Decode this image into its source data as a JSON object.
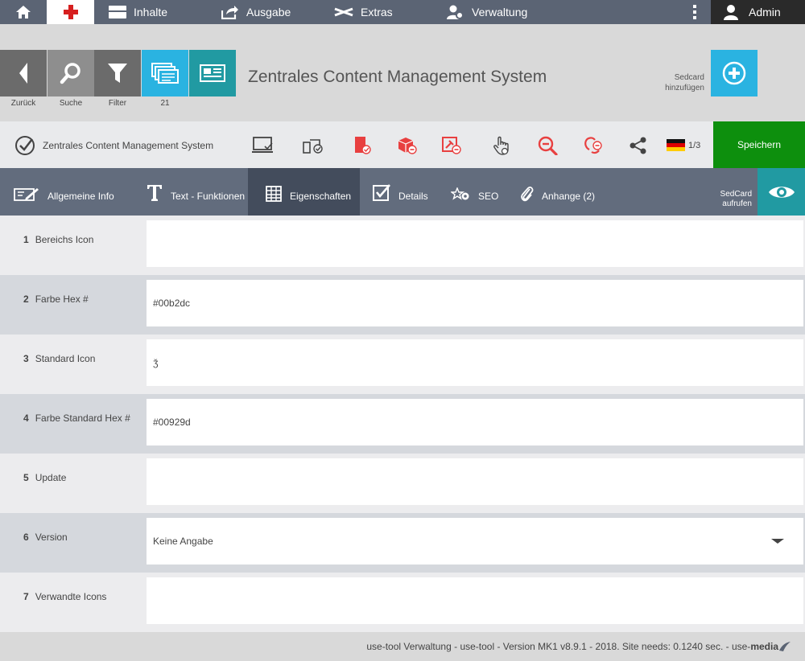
{
  "topnav": {
    "items": [
      {
        "label": "Inhalte",
        "icon": "card-icon"
      },
      {
        "label": "Ausgabe",
        "icon": "share-icon"
      },
      {
        "label": "Extras",
        "icon": "tools-icon"
      },
      {
        "label": "Verwaltung",
        "icon": "user-gear-icon"
      }
    ],
    "admin_label": "Admin",
    "accent_red": "#d61f1f"
  },
  "toolbar": {
    "back_label": "Zurück",
    "search_label": "Suche",
    "filter_label": "Filter",
    "cards_count": "21",
    "title": "Zentrales Content Management System",
    "add_label_line1": "Sedcard",
    "add_label_line2": "hinzufügen"
  },
  "actionbar": {
    "document_label": "Zentrales Content Management System",
    "lang_label": "1/3",
    "save_label": "Speichern",
    "icons": [
      "monitor-check-icon",
      "devices-check-icon",
      "tablet-check-icon",
      "box-remove-icon",
      "pin-remove-icon",
      "hand-pointer-icon",
      "zoom-out-icon",
      "unlink-icon",
      "share-icon"
    ]
  },
  "tabs": [
    {
      "label": "Allgemeine Info",
      "icon": "edit-card-icon"
    },
    {
      "label": "Text - Funktionen",
      "icon": "text-icon"
    },
    {
      "label": "Eigenschaften",
      "icon": "table-icon",
      "active": true
    },
    {
      "label": "Details",
      "icon": "checkbox-icon"
    },
    {
      "label": "SEO",
      "icon": "star-gear-icon"
    },
    {
      "label": "Anhange (2)",
      "icon": "paperclip-icon"
    }
  ],
  "sedcard": {
    "line1": "SedCard",
    "line2": "aufrufen"
  },
  "form": [
    {
      "num": "1",
      "label": "Bereichs Icon",
      "value": ""
    },
    {
      "num": "2",
      "label": "Farbe Hex #",
      "value": "#00b2dc"
    },
    {
      "num": "3",
      "label": "Standard Icon",
      "value": "ǯ"
    },
    {
      "num": "4",
      "label": "Farbe Standard Hex #",
      "value": "#00929d"
    },
    {
      "num": "5",
      "label": "Update",
      "value": ""
    },
    {
      "num": "6",
      "label": "Version",
      "value": "Keine Angabe"
    },
    {
      "num": "7",
      "label": "Verwandte Icons",
      "value": ""
    }
  ],
  "footer": {
    "text": "use-tool Verwaltung - use-tool - Version MK1 v8.9.1 - 2018. Site needs: 0.1240 sec. - use-",
    "brand": "media"
  }
}
